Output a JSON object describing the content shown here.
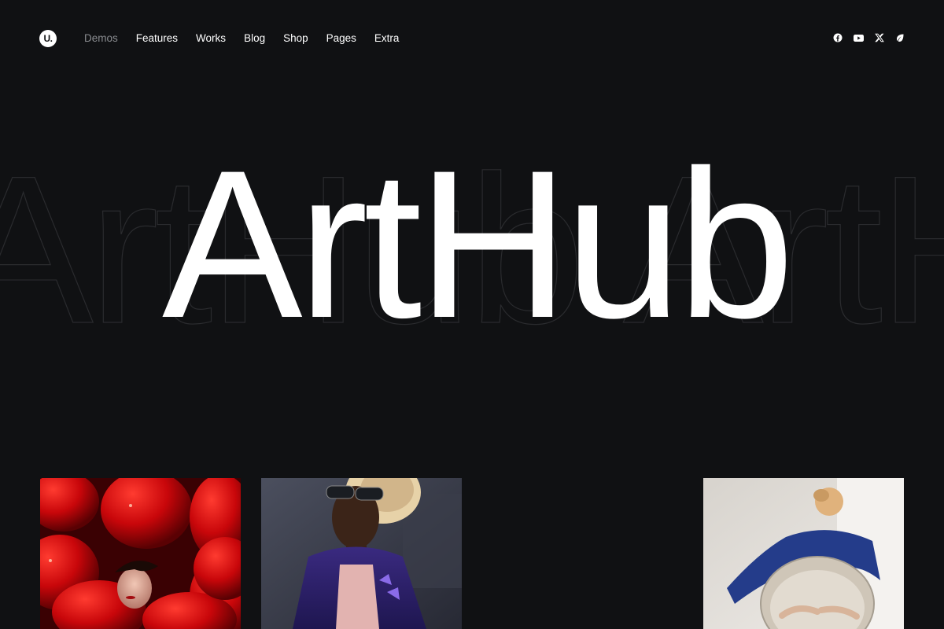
{
  "logo": {
    "text": "U."
  },
  "nav": {
    "items": [
      {
        "label": "Demos",
        "active": false
      },
      {
        "label": "Features"
      },
      {
        "label": "Works"
      },
      {
        "label": "Blog"
      },
      {
        "label": "Shop"
      },
      {
        "label": "Pages"
      },
      {
        "label": "Extra"
      }
    ]
  },
  "social": {
    "icons": [
      "facebook-icon",
      "youtube-icon",
      "x-icon",
      "leaf-icon"
    ]
  },
  "hero": {
    "title": "ArtHub",
    "outline_text": "ArtHub ArtHub"
  },
  "colors": {
    "background": "#101113",
    "text": "#ffffff",
    "nav_dim": "#8a8c90",
    "outline": "#2a2b2e"
  },
  "gallery": [
    {
      "name": "red-balloons-woman-photo"
    },
    {
      "name": "man-sunglasses-hat-photo"
    },
    {
      "name": "woman-blue-mirror-photo"
    }
  ]
}
